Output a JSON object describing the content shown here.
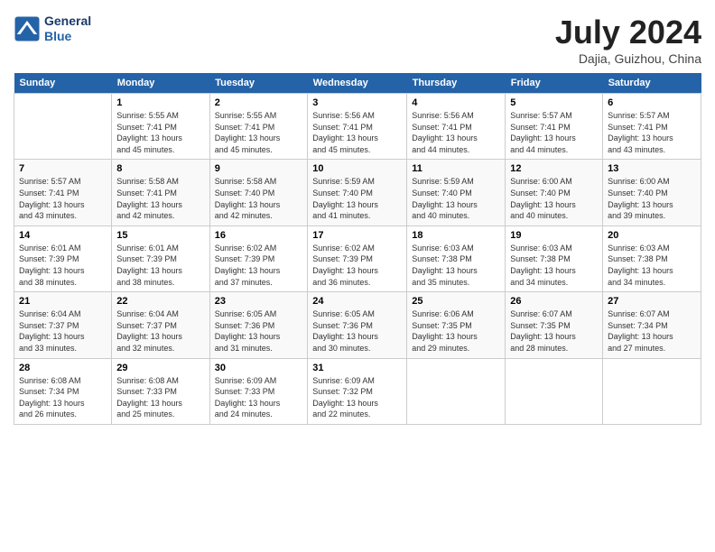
{
  "header": {
    "logo_line1": "General",
    "logo_line2": "Blue",
    "month": "July 2024",
    "location": "Dajia, Guizhou, China"
  },
  "columns": [
    "Sunday",
    "Monday",
    "Tuesday",
    "Wednesday",
    "Thursday",
    "Friday",
    "Saturday"
  ],
  "weeks": [
    [
      {
        "day": "",
        "info": ""
      },
      {
        "day": "1",
        "info": "Sunrise: 5:55 AM\nSunset: 7:41 PM\nDaylight: 13 hours\nand 45 minutes."
      },
      {
        "day": "2",
        "info": "Sunrise: 5:55 AM\nSunset: 7:41 PM\nDaylight: 13 hours\nand 45 minutes."
      },
      {
        "day": "3",
        "info": "Sunrise: 5:56 AM\nSunset: 7:41 PM\nDaylight: 13 hours\nand 45 minutes."
      },
      {
        "day": "4",
        "info": "Sunrise: 5:56 AM\nSunset: 7:41 PM\nDaylight: 13 hours\nand 44 minutes."
      },
      {
        "day": "5",
        "info": "Sunrise: 5:57 AM\nSunset: 7:41 PM\nDaylight: 13 hours\nand 44 minutes."
      },
      {
        "day": "6",
        "info": "Sunrise: 5:57 AM\nSunset: 7:41 PM\nDaylight: 13 hours\nand 43 minutes."
      }
    ],
    [
      {
        "day": "7",
        "info": "Sunrise: 5:57 AM\nSunset: 7:41 PM\nDaylight: 13 hours\nand 43 minutes."
      },
      {
        "day": "8",
        "info": "Sunrise: 5:58 AM\nSunset: 7:41 PM\nDaylight: 13 hours\nand 42 minutes."
      },
      {
        "day": "9",
        "info": "Sunrise: 5:58 AM\nSunset: 7:40 PM\nDaylight: 13 hours\nand 42 minutes."
      },
      {
        "day": "10",
        "info": "Sunrise: 5:59 AM\nSunset: 7:40 PM\nDaylight: 13 hours\nand 41 minutes."
      },
      {
        "day": "11",
        "info": "Sunrise: 5:59 AM\nSunset: 7:40 PM\nDaylight: 13 hours\nand 40 minutes."
      },
      {
        "day": "12",
        "info": "Sunrise: 6:00 AM\nSunset: 7:40 PM\nDaylight: 13 hours\nand 40 minutes."
      },
      {
        "day": "13",
        "info": "Sunrise: 6:00 AM\nSunset: 7:40 PM\nDaylight: 13 hours\nand 39 minutes."
      }
    ],
    [
      {
        "day": "14",
        "info": "Sunrise: 6:01 AM\nSunset: 7:39 PM\nDaylight: 13 hours\nand 38 minutes."
      },
      {
        "day": "15",
        "info": "Sunrise: 6:01 AM\nSunset: 7:39 PM\nDaylight: 13 hours\nand 38 minutes."
      },
      {
        "day": "16",
        "info": "Sunrise: 6:02 AM\nSunset: 7:39 PM\nDaylight: 13 hours\nand 37 minutes."
      },
      {
        "day": "17",
        "info": "Sunrise: 6:02 AM\nSunset: 7:39 PM\nDaylight: 13 hours\nand 36 minutes."
      },
      {
        "day": "18",
        "info": "Sunrise: 6:03 AM\nSunset: 7:38 PM\nDaylight: 13 hours\nand 35 minutes."
      },
      {
        "day": "19",
        "info": "Sunrise: 6:03 AM\nSunset: 7:38 PM\nDaylight: 13 hours\nand 34 minutes."
      },
      {
        "day": "20",
        "info": "Sunrise: 6:03 AM\nSunset: 7:38 PM\nDaylight: 13 hours\nand 34 minutes."
      }
    ],
    [
      {
        "day": "21",
        "info": "Sunrise: 6:04 AM\nSunset: 7:37 PM\nDaylight: 13 hours\nand 33 minutes."
      },
      {
        "day": "22",
        "info": "Sunrise: 6:04 AM\nSunset: 7:37 PM\nDaylight: 13 hours\nand 32 minutes."
      },
      {
        "day": "23",
        "info": "Sunrise: 6:05 AM\nSunset: 7:36 PM\nDaylight: 13 hours\nand 31 minutes."
      },
      {
        "day": "24",
        "info": "Sunrise: 6:05 AM\nSunset: 7:36 PM\nDaylight: 13 hours\nand 30 minutes."
      },
      {
        "day": "25",
        "info": "Sunrise: 6:06 AM\nSunset: 7:35 PM\nDaylight: 13 hours\nand 29 minutes."
      },
      {
        "day": "26",
        "info": "Sunrise: 6:07 AM\nSunset: 7:35 PM\nDaylight: 13 hours\nand 28 minutes."
      },
      {
        "day": "27",
        "info": "Sunrise: 6:07 AM\nSunset: 7:34 PM\nDaylight: 13 hours\nand 27 minutes."
      }
    ],
    [
      {
        "day": "28",
        "info": "Sunrise: 6:08 AM\nSunset: 7:34 PM\nDaylight: 13 hours\nand 26 minutes."
      },
      {
        "day": "29",
        "info": "Sunrise: 6:08 AM\nSunset: 7:33 PM\nDaylight: 13 hours\nand 25 minutes."
      },
      {
        "day": "30",
        "info": "Sunrise: 6:09 AM\nSunset: 7:33 PM\nDaylight: 13 hours\nand 24 minutes."
      },
      {
        "day": "31",
        "info": "Sunrise: 6:09 AM\nSunset: 7:32 PM\nDaylight: 13 hours\nand 22 minutes."
      },
      {
        "day": "",
        "info": ""
      },
      {
        "day": "",
        "info": ""
      },
      {
        "day": "",
        "info": ""
      }
    ]
  ]
}
